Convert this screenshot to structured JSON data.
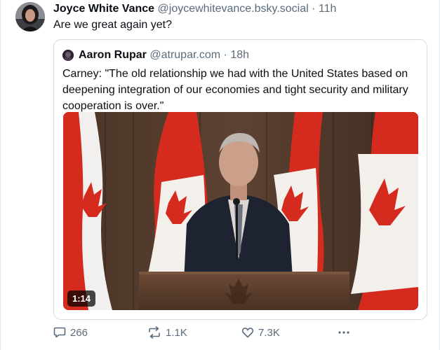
{
  "post": {
    "author_name": "Joyce White Vance",
    "author_handle": "@joycewhitevance.bsky.social",
    "separator": "·",
    "time": "11h",
    "text": "Are we great again yet?"
  },
  "quote": {
    "author_name": "Aaron Rupar",
    "author_handle": "@atrupar.com",
    "separator": "·",
    "time": "18h",
    "text": "Carney: \"The old relationship we had with the United States based on deepening integration of our economies and tight security and military cooperation is over.\"",
    "video": {
      "duration": "1:14"
    }
  },
  "actions": {
    "replies": "266",
    "reposts": "1.1K",
    "likes": "7.3K"
  },
  "icons": {
    "reply": "speech-bubble-icon",
    "repost": "repost-arrows-icon",
    "like": "heart-icon",
    "more": "more-dots-icon"
  },
  "colors": {
    "text": "#0b0f14",
    "muted": "#5b6b7b",
    "border": "#d4dbe2",
    "flag_red": "#d52b1e"
  }
}
